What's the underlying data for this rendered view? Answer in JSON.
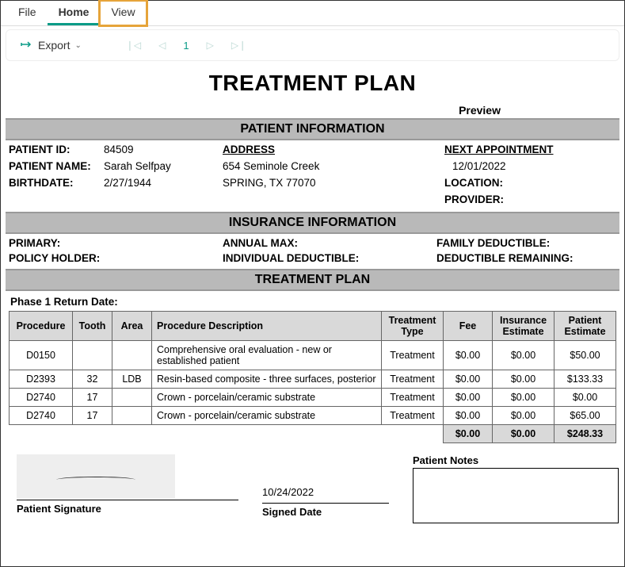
{
  "tabs": {
    "file": "File",
    "home": "Home",
    "view": "View"
  },
  "toolbar": {
    "export": "Export",
    "page": "1"
  },
  "doc": {
    "title": "TREATMENT PLAN",
    "preview": "Preview",
    "sections": {
      "patient": "PATIENT INFORMATION",
      "insurance": "INSURANCE INFORMATION",
      "plan": "TREATMENT PLAN"
    },
    "patient": {
      "id_lbl": "PATIENT ID:",
      "id": "84509",
      "name_lbl": "PATIENT NAME:",
      "name": "Sarah Selfpay",
      "birth_lbl": "BIRTHDATE:",
      "birth": "2/27/1944",
      "addr_hdr": "ADDRESS",
      "addr1": "654 Seminole Creek",
      "addr2": "SPRING, TX 77070",
      "next_hdr": "NEXT APPOINTMENT",
      "next": "12/01/2022",
      "loc_lbl": "LOCATION:",
      "prov_lbl": "PROVIDER:"
    },
    "insurance": {
      "primary_lbl": "PRIMARY:",
      "annual_lbl": "ANNUAL MAX:",
      "family_lbl": "FAMILY DEDUCTIBLE:",
      "policy_lbl": "POLICY HOLDER:",
      "indiv_lbl": "INDIVIDUAL DEDUCTIBLE:",
      "remain_lbl": "DEDUCTIBLE REMAINING:"
    },
    "phase": "Phase 1  Return Date:",
    "cols": {
      "proc": "Procedure",
      "tooth": "Tooth",
      "area": "Area",
      "desc": "Procedure Description",
      "type": "Treatment Type",
      "fee": "Fee",
      "ins": "Insurance Estimate",
      "pat": "Patient Estimate"
    },
    "rows": [
      {
        "proc": "D0150",
        "tooth": "",
        "area": "",
        "desc": "Comprehensive oral evaluation - new or established patient",
        "type": "Treatment",
        "fee": "$0.00",
        "ins": "$0.00",
        "pat": "$50.00"
      },
      {
        "proc": "D2393",
        "tooth": "32",
        "area": "LDB",
        "desc": "Resin-based composite - three surfaces, posterior",
        "type": "Treatment",
        "fee": "$0.00",
        "ins": "$0.00",
        "pat": "$133.33"
      },
      {
        "proc": "D2740",
        "tooth": "17",
        "area": "",
        "desc": "Crown - porcelain/ceramic substrate",
        "type": "Treatment",
        "fee": "$0.00",
        "ins": "$0.00",
        "pat": "$0.00"
      },
      {
        "proc": "D2740",
        "tooth": "17",
        "area": "",
        "desc": "Crown - porcelain/ceramic substrate",
        "type": "Treatment",
        "fee": "$0.00",
        "ins": "$0.00",
        "pat": "$65.00"
      }
    ],
    "totals": {
      "fee": "$0.00",
      "ins": "$0.00",
      "pat": "$248.33"
    },
    "sig": {
      "siglbl": "Patient Signature",
      "date": "10/24/2022",
      "datelbl": "Signed Date",
      "noteslbl": "Patient Notes"
    }
  }
}
